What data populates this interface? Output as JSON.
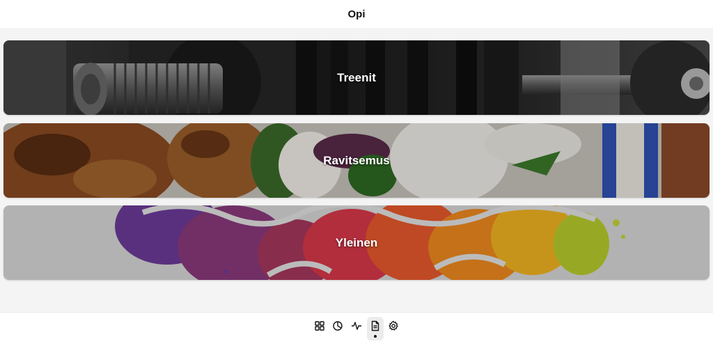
{
  "header": {
    "title": "Opi"
  },
  "cards": [
    {
      "label": "Treenit",
      "image": "barbell-weights-photo"
    },
    {
      "label": "Ravitsemus",
      "image": "chicken-salad-photo"
    },
    {
      "label": "Yleinen",
      "image": "watercolor-brain-illustration"
    }
  ],
  "tabbar": {
    "tabs": [
      {
        "icon": "grid-icon",
        "active": false
      },
      {
        "icon": "pie-chart-icon",
        "active": false
      },
      {
        "icon": "activity-icon",
        "active": false
      },
      {
        "icon": "document-icon",
        "active": true
      },
      {
        "icon": "gear-icon",
        "active": false
      }
    ]
  },
  "colors": {
    "header_bg": "#ffffff",
    "content_bg": "#f4f4f4",
    "active_tab_bg": "#ececec"
  }
}
